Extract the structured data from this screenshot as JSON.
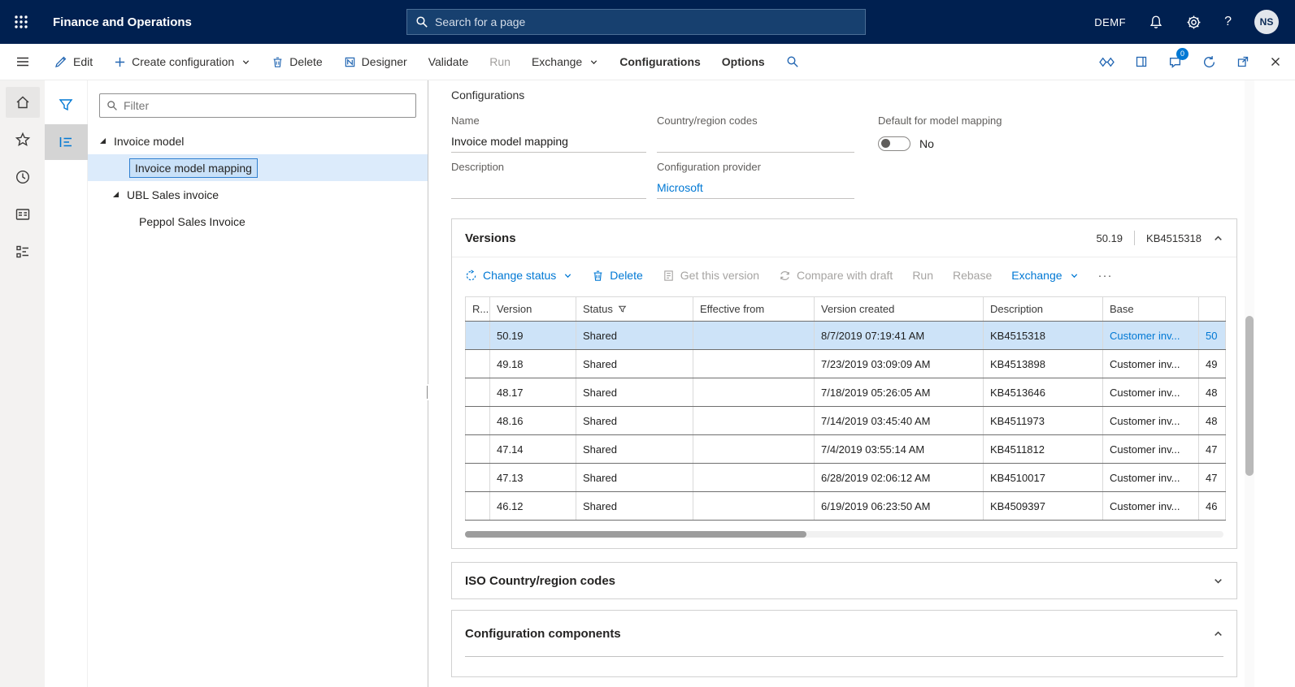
{
  "topbar": {
    "app_title": "Finance and Operations",
    "search_placeholder": "Search for a page",
    "company": "DEMF",
    "help": "?",
    "avatar_initials": "NS"
  },
  "actionbar": {
    "edit": "Edit",
    "create_configuration": "Create configuration",
    "delete": "Delete",
    "designer": "Designer",
    "validate": "Validate",
    "run": "Run",
    "exchange": "Exchange",
    "configurations": "Configurations",
    "options": "Options",
    "message_badge": "0"
  },
  "nav_pane": {
    "filter_placeholder": "Filter"
  },
  "tree": {
    "items": [
      {
        "label": "Invoice model"
      },
      {
        "label": "Invoice model mapping"
      },
      {
        "label": "UBL Sales invoice"
      },
      {
        "label": "Peppol Sales Invoice"
      }
    ]
  },
  "form": {
    "section_title": "Configurations",
    "name_label": "Name",
    "name_value": "Invoice model mapping",
    "country_label": "Country/region codes",
    "country_value": "",
    "default_label": "Default for model mapping",
    "default_value": "No",
    "description_label": "Description",
    "description_value": "",
    "provider_label": "Configuration provider",
    "provider_value": "Microsoft"
  },
  "versions": {
    "title": "Versions",
    "current_version": "50.19",
    "current_kb": "KB4515318",
    "toolbar": {
      "change_status": "Change status",
      "delete": "Delete",
      "get_this_version": "Get this version",
      "compare_with_draft": "Compare with draft",
      "run": "Run",
      "rebase": "Rebase",
      "exchange": "Exchange",
      "more": "···"
    },
    "columns": {
      "rowsel": "R...",
      "version": "Version",
      "status": "Status",
      "effective": "Effective from",
      "created": "Version created",
      "description": "Description",
      "base": "Base",
      "base_version": ""
    },
    "rows": [
      {
        "version": "50.19",
        "status": "Shared",
        "effective": "",
        "created": "8/7/2019 07:19:41 AM",
        "description": "KB4515318",
        "base": "Customer inv...",
        "base_version": "50"
      },
      {
        "version": "49.18",
        "status": "Shared",
        "effective": "",
        "created": "7/23/2019 03:09:09 AM",
        "description": "KB4513898",
        "base": "Customer inv...",
        "base_version": "49"
      },
      {
        "version": "48.17",
        "status": "Shared",
        "effective": "",
        "created": "7/18/2019 05:26:05 AM",
        "description": "KB4513646",
        "base": "Customer inv...",
        "base_version": "48"
      },
      {
        "version": "48.16",
        "status": "Shared",
        "effective": "",
        "created": "7/14/2019 03:45:40 AM",
        "description": "KB4511973",
        "base": "Customer inv...",
        "base_version": "48"
      },
      {
        "version": "47.14",
        "status": "Shared",
        "effective": "",
        "created": "7/4/2019 03:55:14 AM",
        "description": "KB4511812",
        "base": "Customer inv...",
        "base_version": "47"
      },
      {
        "version": "47.13",
        "status": "Shared",
        "effective": "",
        "created": "6/28/2019 02:06:12 AM",
        "description": "KB4510017",
        "base": "Customer inv...",
        "base_version": "47"
      },
      {
        "version": "46.12",
        "status": "Shared",
        "effective": "",
        "created": "6/19/2019 06:23:50 AM",
        "description": "KB4509397",
        "base": "Customer inv...",
        "base_version": "46"
      }
    ]
  },
  "sections": {
    "iso_title": "ISO Country/region codes",
    "components_title": "Configuration components"
  }
}
